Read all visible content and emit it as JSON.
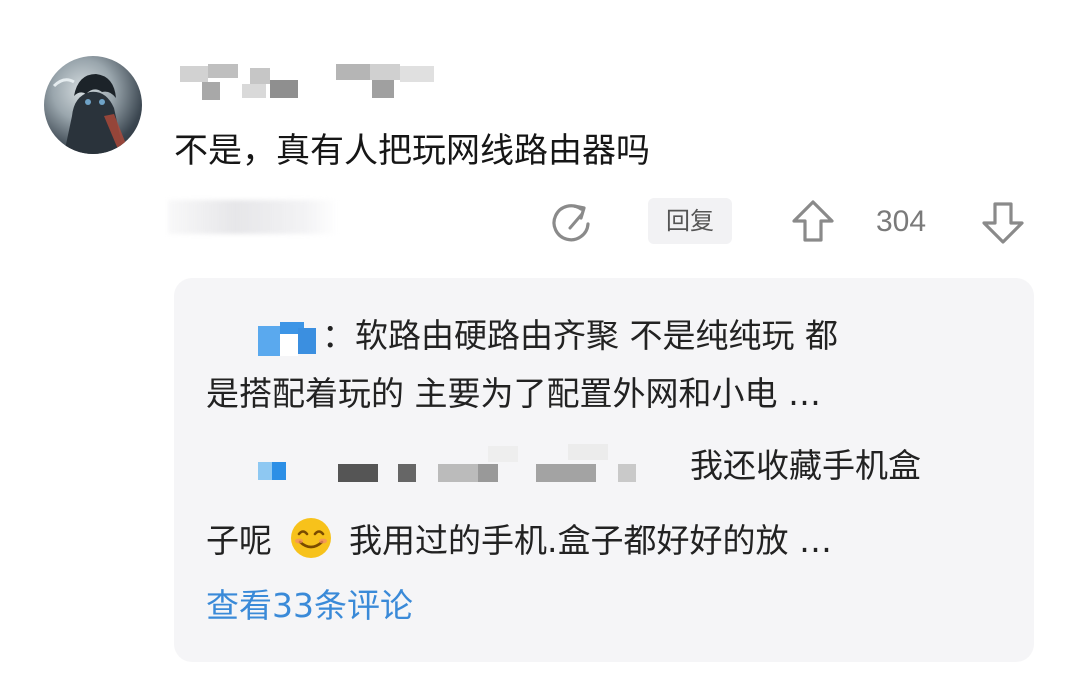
{
  "comment": {
    "text": "不是，真有人把玩网线路由器吗",
    "reply_label": "回复",
    "vote_count": "304"
  },
  "replies": {
    "reply1_line1": "：软路由硬路由齐聚 不是纯纯玩 都",
    "reply1_line2": "是搭配着玩的 主要为了配置外网和小电 …",
    "reply2_line1": "我还收藏手机盒",
    "reply2_line2_a": "子呢",
    "reply2_line2_b": "我用过的手机.盒子都好好的放 …",
    "view_more": "查看33条评论"
  },
  "icons": {
    "share": "refresh-share-icon",
    "upvote": "arrow-up-icon",
    "downvote": "arrow-down-icon",
    "emoji": "smile-emoji-icon"
  },
  "colors": {
    "link": "#3a8ad8",
    "reply_bg": "#f5f5f7",
    "reply_button_bg": "#f2f2f4"
  }
}
